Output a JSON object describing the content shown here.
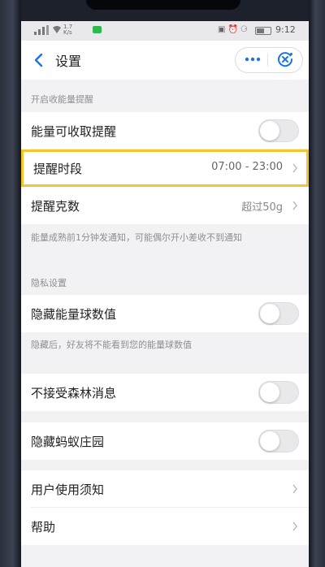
{
  "status_bar": {
    "network_speed": "1.7\nK/s",
    "time": "9:12"
  },
  "navbar": {
    "title": "设置",
    "back_icon": "chevron-left-icon",
    "more_icon": "more-dots-icon",
    "close_icon": "close-circle-icon",
    "accent": "#1a73e8"
  },
  "energy_section": {
    "header": "开启收能量提醒",
    "rows": [
      {
        "label": "能量可收取提醒",
        "toggle_on": false
      },
      {
        "label": "提醒时段",
        "value": "07:00 - 23:00"
      },
      {
        "label": "提醒克数",
        "value": "超过50g"
      }
    ],
    "footnote": "能量成熟前1分钟发通知，可能偶尔开小差收不到通知"
  },
  "privacy_section": {
    "header": "隐私设置",
    "hide_energy": {
      "label": "隐藏能量球数值",
      "toggle_on": false
    },
    "footnote": "隐藏后，好友将不能看到您的能量球数值"
  },
  "forest_messages": {
    "label": "不接受森林消息",
    "toggle_on": false
  },
  "hide_farm": {
    "label": "隐藏蚂蚁庄园",
    "toggle_on": false
  },
  "links": [
    {
      "label": "用户使用须知"
    },
    {
      "label": "帮助"
    }
  ],
  "colors": {
    "highlight_border": "#f3c531",
    "background": "#f2f2f4"
  }
}
